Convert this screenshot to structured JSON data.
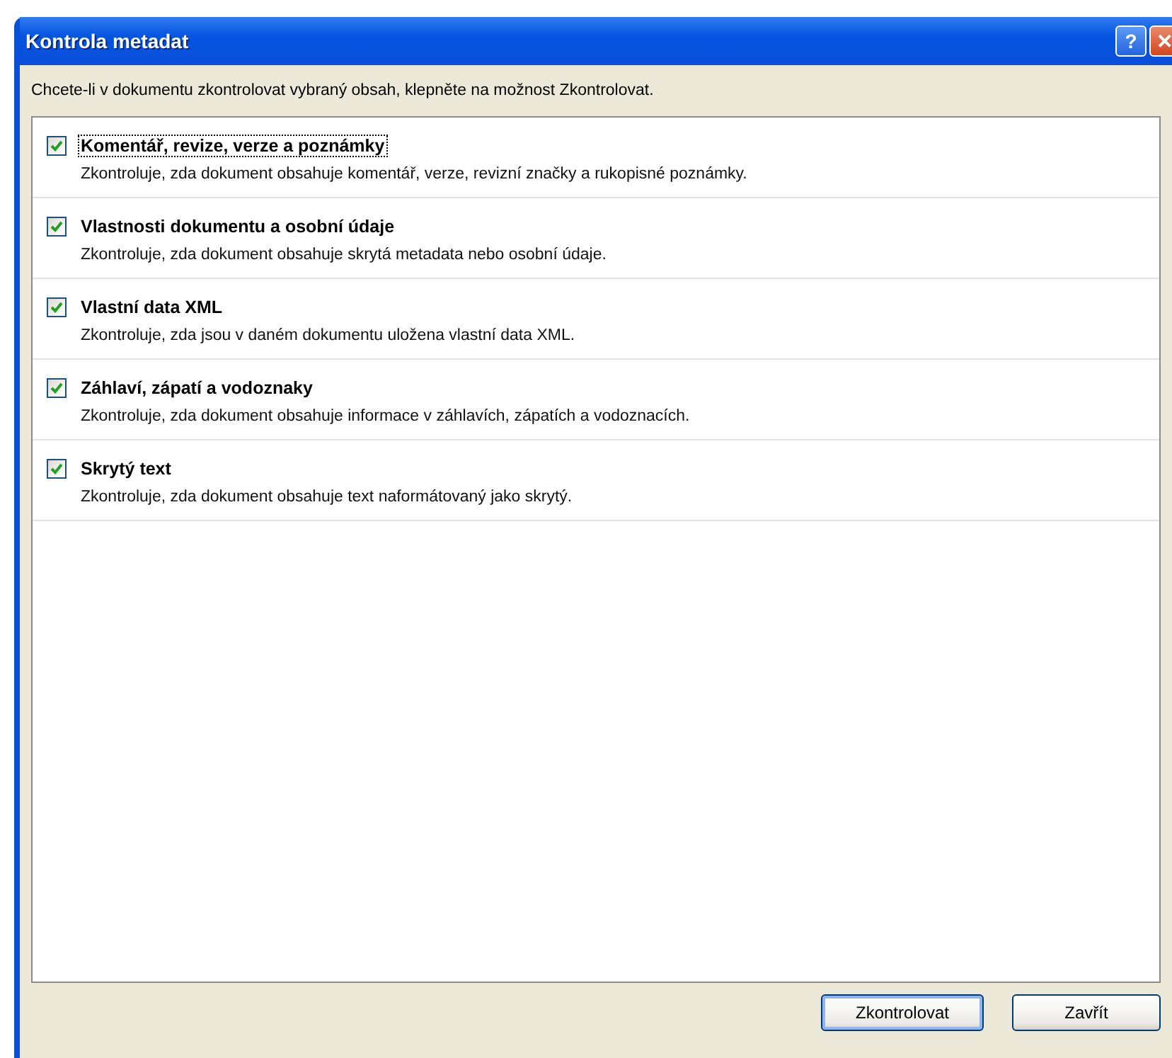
{
  "window": {
    "title": "Kontrola metadat",
    "title_buttons": [
      "?",
      "✕"
    ]
  },
  "instruction": "Chcete-li v dokumentu zkontrolovat vybraný obsah, klepněte na možnost Zkontrolovat.",
  "items": [
    {
      "label": "Komentář, revize, verze a poznámky",
      "description": "Zkontroluje, zda dokument obsahuje komentář, verze, revizní značky a rukopisné poznámky.",
      "checked": true,
      "focused": true
    },
    {
      "label": "Vlastnosti dokumentu a osobní údaje",
      "description": "Zkontroluje, zda dokument obsahuje skrytá metadata nebo osobní údaje.",
      "checked": true,
      "focused": false
    },
    {
      "label": "Vlastní data XML",
      "description": "Zkontroluje, zda jsou v daném dokumentu uložena vlastní data XML.",
      "checked": true,
      "focused": false
    },
    {
      "label": "Záhlaví, zápatí a vodoznaky",
      "description": "Zkontroluje, zda dokument obsahuje informace v záhlavích, zápatích a vodoznacích.",
      "checked": true,
      "focused": false
    },
    {
      "label": "Skrytý text",
      "description": "Zkontroluje, zda dokument obsahuje text naformátovaný jako skrytý.",
      "checked": true,
      "focused": false
    }
  ],
  "buttons": [
    {
      "label": "Zkontrolovat",
      "default": true
    },
    {
      "label": "Zavřít",
      "default": false
    }
  ]
}
